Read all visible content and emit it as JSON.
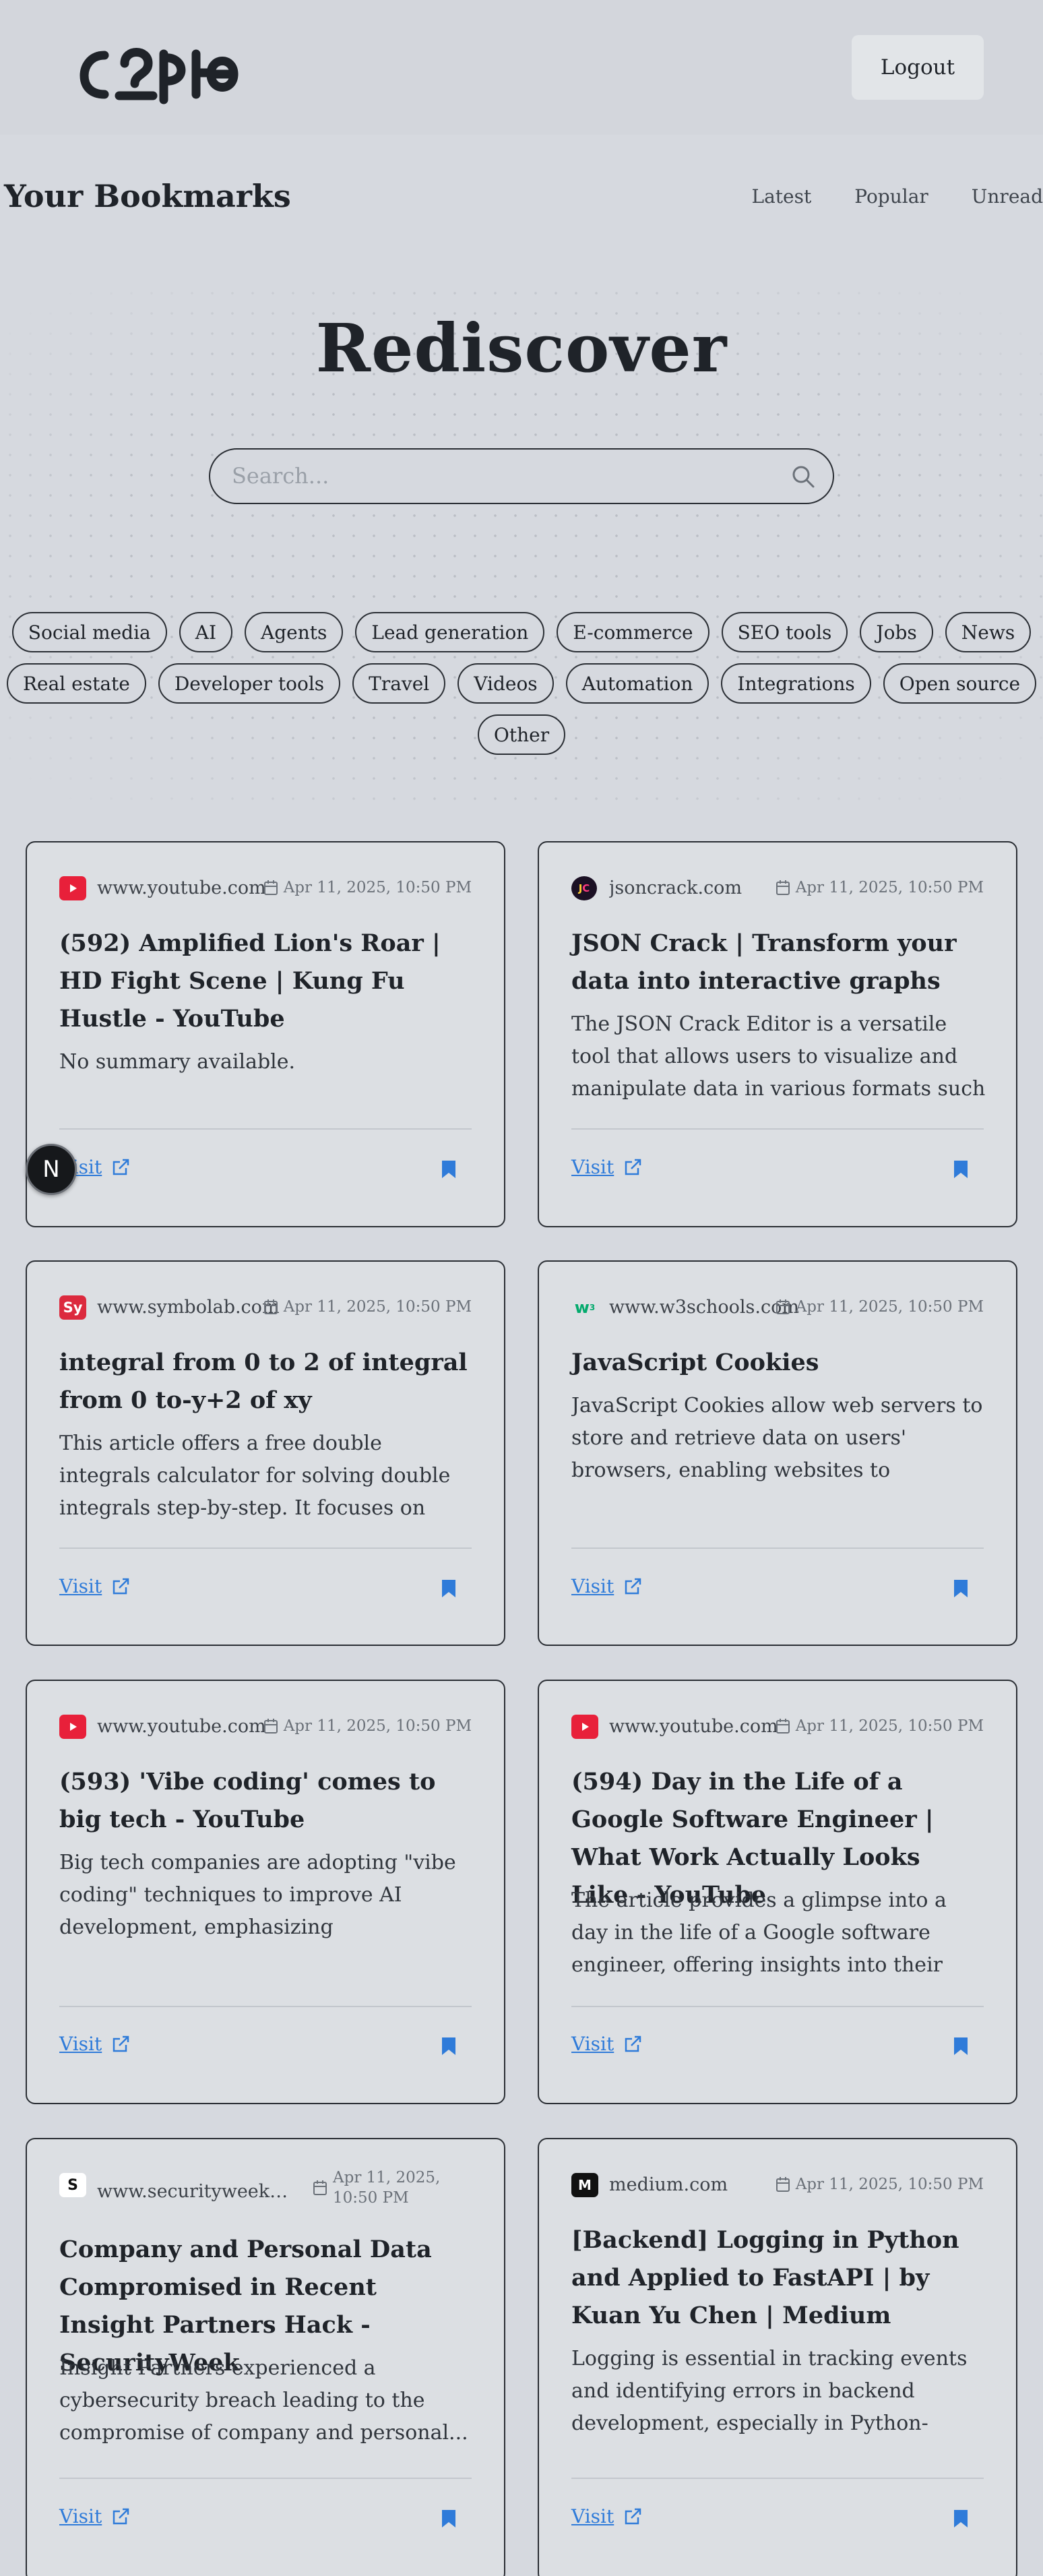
{
  "header": {
    "logo_alt": "c?pe",
    "logout_label": "Logout"
  },
  "page": {
    "title": "Your Bookmarks",
    "nav": [
      "Latest",
      "Popular",
      "Unread"
    ]
  },
  "hero": {
    "title": "Rediscover",
    "search_placeholder": "Search..."
  },
  "tags": {
    "row1": [
      "Social media",
      "AI",
      "Agents",
      "Lead generation",
      "E-commerce",
      "SEO tools",
      "Jobs",
      "News"
    ],
    "row2": [
      "Real estate",
      "Developer tools",
      "Travel",
      "Videos",
      "Automation",
      "Integrations",
      "Open source"
    ],
    "row3": [
      "Other"
    ]
  },
  "cards": [
    {
      "domain": "www.youtube.com",
      "icon": "youtube-icon",
      "date": "Apr 11, 2025, 10:50 PM",
      "title": "(592) Amplified Lion's Roar | HD Fight Scene | Kung Fu Hustle - YouTube",
      "summary": "No summary available.",
      "visit": "Visit"
    },
    {
      "domain": "jsoncrack.com",
      "icon": "jsoncrack-icon",
      "date": "Apr 11, 2025, 10:50 PM",
      "title": "JSON Crack | Transform your data into interactive graphs",
      "summary": "The JSON Crack Editor is a versatile tool that allows users to visualize and manipulate data in various formats such ...",
      "visit": "Visit"
    },
    {
      "domain": "www.symbolab.com",
      "icon": "symbolab-icon",
      "date": "Apr 11, 2025, 10:50 PM",
      "title": "integral from 0 to 2 of integral from 0 to-y+2 of xy",
      "summary": "This article offers a free double integrals calculator for solving double integrals step-by-step. It focuses on providing a to...",
      "visit": "Visit"
    },
    {
      "domain": "www.w3schools.com",
      "icon": "w3schools-icon",
      "date": "Apr 11, 2025, 10:50 PM",
      "title": "JavaScript Cookies",
      "summary": "JavaScript Cookies allow web servers to store and retrieve data on users' browsers, enabling websites to remember user...",
      "visit": "Visit"
    },
    {
      "domain": "www.youtube.com",
      "icon": "youtube-icon",
      "date": "Apr 11, 2025, 10:50 PM",
      "title": "(593) 'Vibe coding' comes to big tech - YouTube",
      "summary": "Big tech companies are adopting \"vibe coding\" techniques to improve AI development, emphasizing collaboration...",
      "visit": "Visit"
    },
    {
      "domain": "www.youtube.com",
      "icon": "youtube-icon",
      "date": "Apr 11, 2025, 10:50 PM",
      "title": "(594) Day in the Life of a Google Software Engineer | What Work Actually Looks Like - YouTube",
      "summary": "The article provides a glimpse into a day in the life of a Google software engineer, offering insights into their work routine...",
      "visit": "Visit"
    },
    {
      "domain": "www.securityweek.c...",
      "icon": "securityweek-icon",
      "date": "Apr 11, 2025, 10:50 PM",
      "title": "Company and Personal Data Compromised in Recent Insight Partners Hack  - SecurityWeek",
      "summary": "Insight Partners experienced a cybersecurity breach leading to the compromise of company and personal...",
      "visit": "Visit"
    },
    {
      "domain": "medium.com",
      "icon": "medium-icon",
      "date": "Apr 11, 2025, 10:50 PM",
      "title": "[Backend] Logging in Python and Applied to FastAPI | by Kuan Yu Chen | Medium",
      "summary": "Logging is essential in tracking events and identifying errors in backend development, especially in Python-based frameworks...",
      "visit": "Visit"
    }
  ],
  "overlay": {
    "badge_letter": "N"
  },
  "colors": {
    "link": "#2f7bd9",
    "youtube": "#e8203a",
    "symbolab": "#dc2a3e",
    "w3schools": "#04aa6d",
    "bookmark": "#2f7bd9"
  }
}
